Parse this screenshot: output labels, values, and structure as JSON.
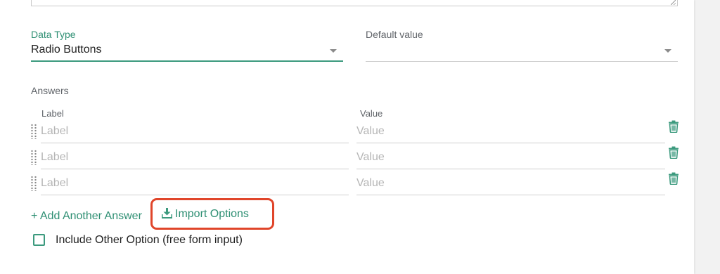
{
  "form": {
    "data_type": {
      "label": "Data Type",
      "value": "Radio Buttons"
    },
    "default_value": {
      "label": "Default value",
      "value": ""
    }
  },
  "answers": {
    "title": "Answers",
    "columns": {
      "label": "Label",
      "value": "Value"
    },
    "rows": [
      {
        "label_placeholder": "Label",
        "value_placeholder": "Value"
      },
      {
        "label_placeholder": "Label",
        "value_placeholder": "Value"
      },
      {
        "label_placeholder": "Label",
        "value_placeholder": "Value"
      }
    ]
  },
  "actions": {
    "add_answer": "+ Add Another Answer",
    "import_options": "Import Options"
  },
  "include_other": {
    "label": "Include Other Option (free form input)",
    "checked": false
  },
  "colors": {
    "accent": "#2e8f73",
    "highlight": "#e0452a"
  },
  "icons": {
    "trash": "trash-icon",
    "drag": "drag-handle-icon",
    "download": "download-icon",
    "caret": "chevron-down-icon"
  }
}
